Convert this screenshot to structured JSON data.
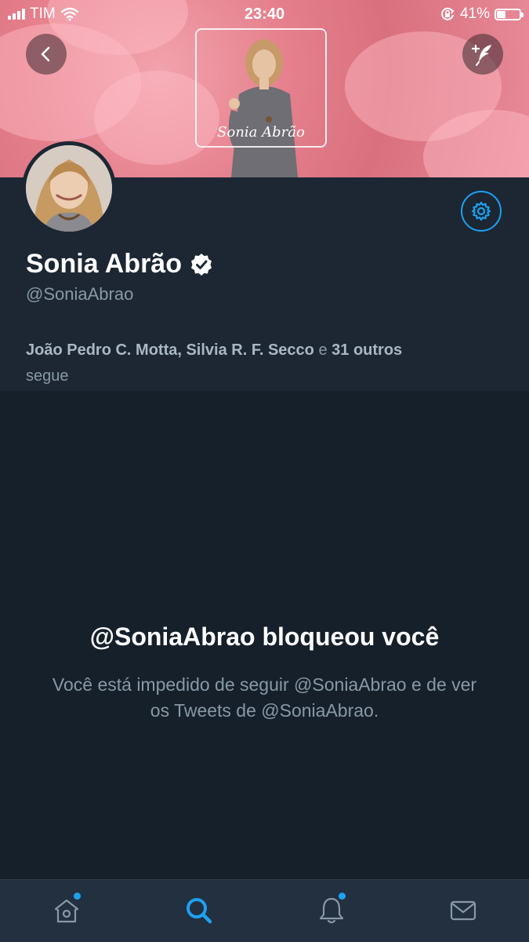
{
  "status_bar": {
    "carrier": "TIM",
    "time": "23:40",
    "battery_percent": "41%",
    "battery_level": 0.41
  },
  "header": {
    "back_icon": "chevron-left-icon",
    "compose_icon": "compose-tweet-icon",
    "banner_caption": "Sonia Abrão"
  },
  "profile": {
    "name": "Sonia Abrão",
    "handle": "@SoniaAbrao",
    "verified": true,
    "followed_by": {
      "names": "João Pedro C. Motta, Silvia R. F. Secco",
      "conjunction": "e",
      "count_bold": "31",
      "others_bold": "outros",
      "suffix": "segue"
    }
  },
  "blocked": {
    "title": "@SoniaAbrao bloqueou você",
    "description": "Você está impedido de seguir @SoniaAbrao e de ver os Tweets de @SoniaAbrao."
  },
  "tabs": [
    {
      "name": "home",
      "icon": "home-icon",
      "active": false,
      "badge": true
    },
    {
      "name": "search",
      "icon": "search-icon",
      "active": true,
      "badge": false
    },
    {
      "name": "notifications",
      "icon": "bell-icon",
      "active": false,
      "badge": true
    },
    {
      "name": "messages",
      "icon": "mail-icon",
      "active": false,
      "badge": false
    }
  ],
  "colors": {
    "accent": "#1da1f2",
    "background": "#15202b",
    "header_bg": "#1c2733",
    "muted_text": "#8899a6"
  }
}
